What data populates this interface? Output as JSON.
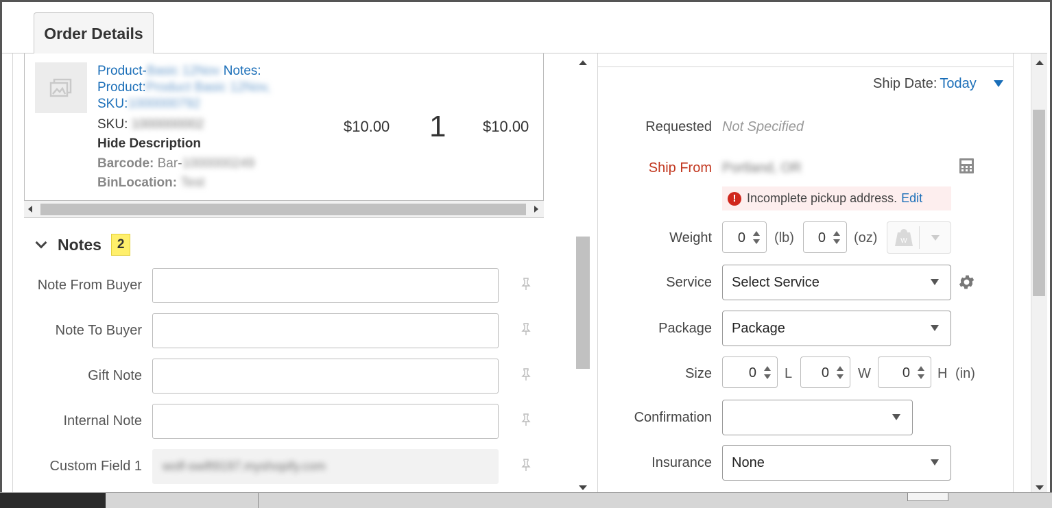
{
  "tab": {
    "title": "Order Details"
  },
  "item": {
    "link_line1": "Product-",
    "link_line1_blur": "Basic 12Nov",
    "link_line1_end": " Notes:",
    "link_line2": "Product:",
    "link_line2_blur": "Product Basic 12Nov,",
    "link_line3": "SKU:",
    "link_line3_blur": "1000000792",
    "sku_label": "SKU: ",
    "sku_blur": "1000000002",
    "hide_description": "Hide Description",
    "barcode_label": "Barcode:",
    "barcode_value": " Bar-",
    "barcode_blur": "1000000249",
    "binlocation_label": "BinLocation:",
    "binlocation_blur": "Test",
    "price": "$10.00",
    "quantity": "1",
    "total": "$10.00"
  },
  "notes": {
    "title": "Notes",
    "count": "2",
    "fields": [
      {
        "label": "Note From Buyer",
        "value": ""
      },
      {
        "label": "Note To Buyer",
        "value": ""
      },
      {
        "label": "Gift Note",
        "value": ""
      },
      {
        "label": "Internal Note",
        "value": ""
      },
      {
        "label": "Custom Field 1",
        "value": "wolf-swift9197.myshopify.com"
      }
    ]
  },
  "shipping": {
    "ship_date_label": "Ship Date:",
    "ship_date_value": "Today",
    "requested_label": "Requested",
    "requested_value": "Not Specified",
    "ship_from_label": "Ship From",
    "ship_from_value": "Portland, OR",
    "alert_text": "Incomplete pickup address.",
    "alert_edit": "Edit",
    "weight_label": "Weight",
    "weight_lb": "0",
    "unit_lb": "(lb)",
    "weight_oz": "0",
    "unit_oz": "(oz)",
    "service_label": "Service",
    "service_value": "Select Service",
    "package_label": "Package",
    "package_value": "Package",
    "size_label": "Size",
    "size_l": "0",
    "unit_l": "L",
    "size_w": "0",
    "unit_w": "W",
    "size_h": "0",
    "unit_h": "H",
    "unit_in": "(in)",
    "confirmation_label": "Confirmation",
    "confirmation_value": "",
    "insurance_label": "Insurance",
    "insurance_value": "None"
  },
  "colors": {
    "link": "#1a6eb8",
    "alert_red": "#d0271d",
    "label_red": "#c2371f",
    "badge_yellow": "#ffef6b"
  }
}
